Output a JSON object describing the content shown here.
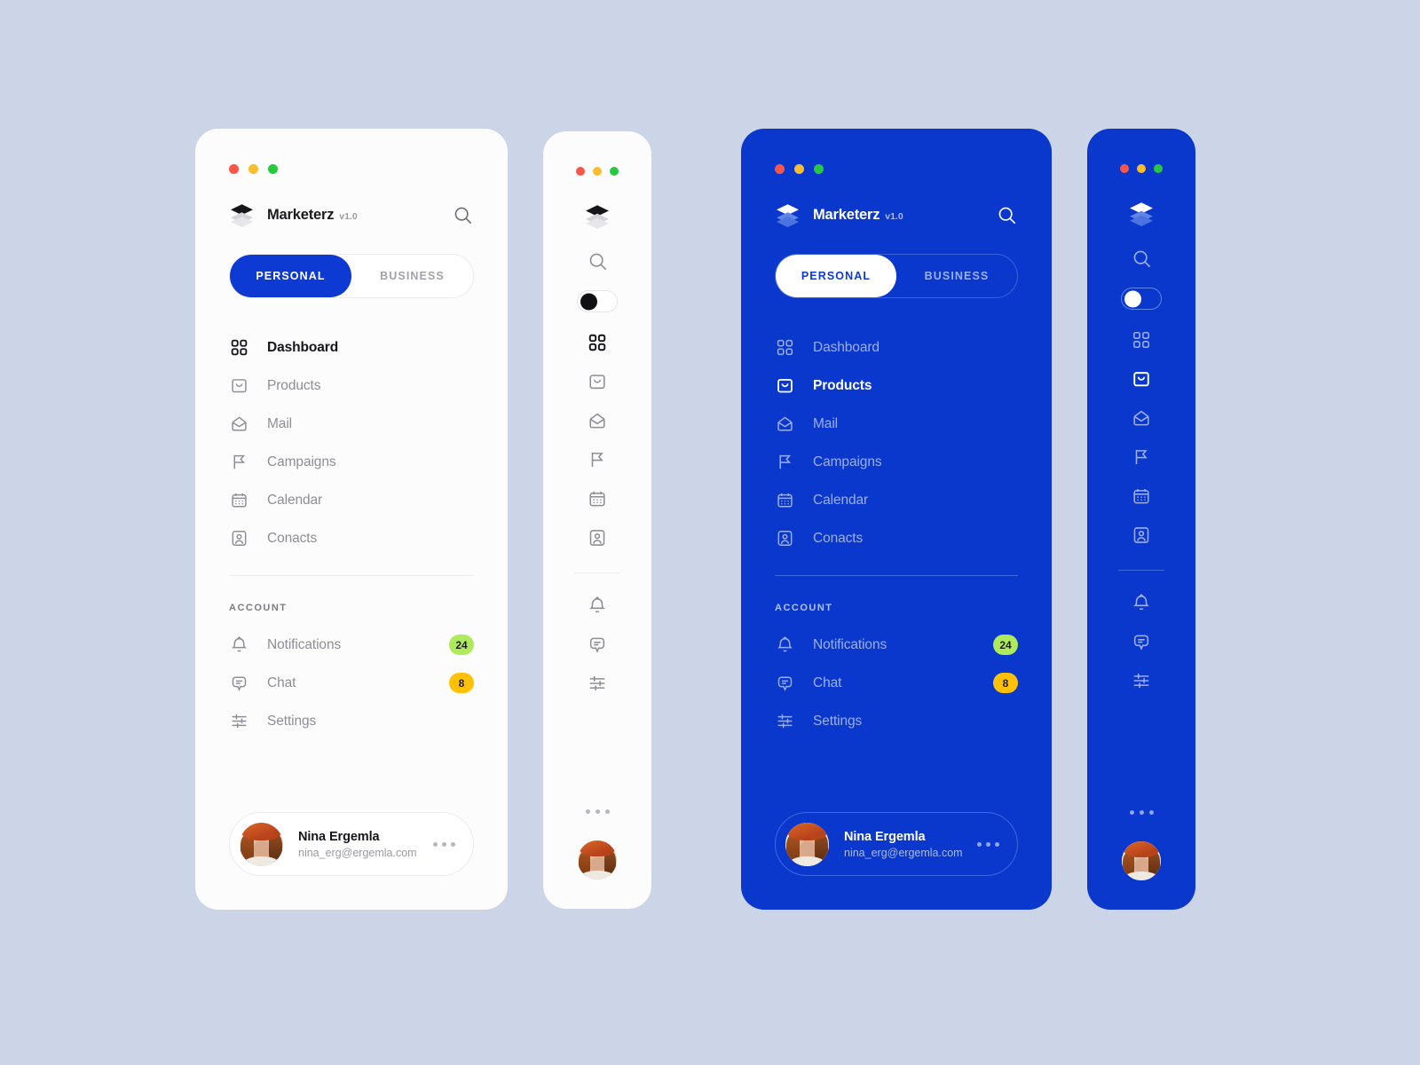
{
  "app": {
    "brand_name": "Marketerz",
    "version_label": "v1.0",
    "logo_icon": "layers-icon",
    "search_icon": "search-icon"
  },
  "window_controls": {
    "close_label": "close",
    "minimize_label": "minimize",
    "maximize_label": "maximize",
    "close_color": "#f9564a",
    "minimize_color": "#f9bd2e",
    "maximize_color": "#28c840"
  },
  "tabs": [
    {
      "label": "PERSONAL",
      "active_light": true,
      "active_dark": true
    },
    {
      "label": "BUSINESS",
      "active_light": false,
      "active_dark": false
    }
  ],
  "nav": {
    "items": [
      {
        "label": "Dashboard",
        "icon": "grid-icon"
      },
      {
        "label": "Products",
        "icon": "bag-icon"
      },
      {
        "label": "Mail",
        "icon": "envelope-icon"
      },
      {
        "label": "Campaigns",
        "icon": "flag-icon"
      },
      {
        "label": "Calendar",
        "icon": "calendar-icon"
      },
      {
        "label": "Conacts",
        "icon": "contact-icon"
      }
    ],
    "active_light": "Dashboard",
    "active_dark": "Products"
  },
  "account": {
    "section_label": "ACCOUNT",
    "items": [
      {
        "label": "Notifications",
        "icon": "bell-icon",
        "badge": "24",
        "badge_color": "#aeea5b"
      },
      {
        "label": "Chat",
        "icon": "chat-icon",
        "badge": "8",
        "badge_color": "#ffc107"
      },
      {
        "label": "Settings",
        "icon": "sliders-icon",
        "badge": "",
        "badge_color": ""
      }
    ]
  },
  "profile": {
    "name": "Nina Ergemla",
    "email": "nina_erg@ergemla.com",
    "avatar_icon": "user-avatar",
    "more_icon": "more-dots-icon"
  },
  "rail": {
    "toggle_state": "off",
    "more_icon": "more-dots-icon"
  },
  "theme": {
    "page_background": "#ccd5e8",
    "light_panel": "#fcfcfc",
    "dark_panel": "#0a37cc",
    "accent_blue": "#0e3ad4"
  }
}
